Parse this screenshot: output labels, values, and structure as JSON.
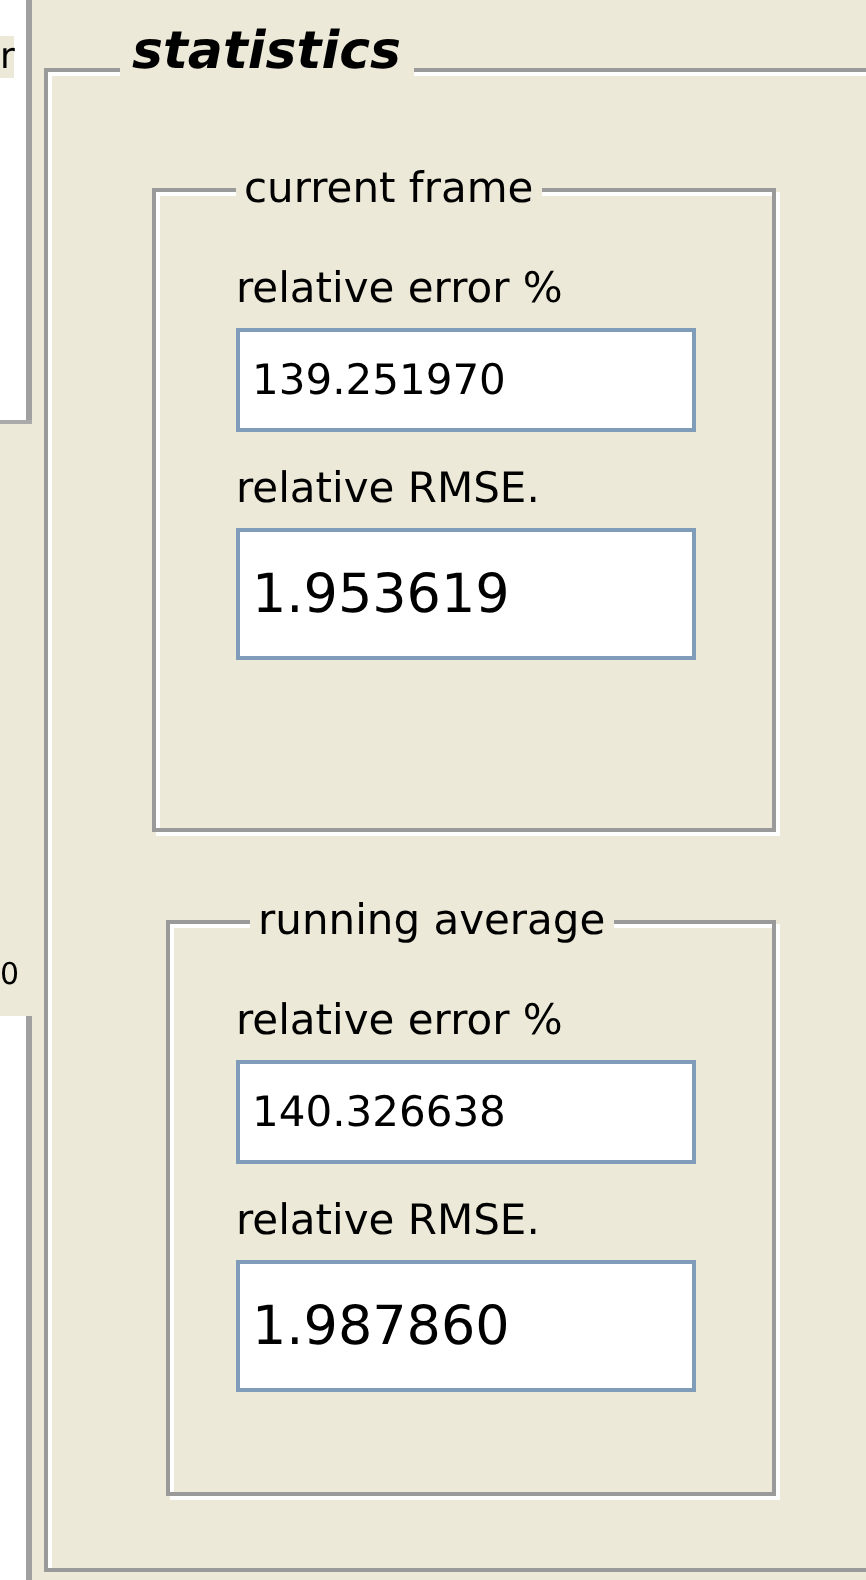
{
  "left_panel": {
    "top_text": "r",
    "bottom_text": "0"
  },
  "statistics": {
    "title": "statistics",
    "groups": [
      {
        "title": "current frame",
        "fields": [
          {
            "label": "relative error %",
            "value": "139.251970",
            "kind": "small"
          },
          {
            "label": "relative RMSE.",
            "value": "1.953619",
            "kind": "large"
          }
        ]
      },
      {
        "title": "running average",
        "fields": [
          {
            "label": "relative error %",
            "value": "140.326638",
            "kind": "small"
          },
          {
            "label": "relative RMSE.",
            "value": "1.987860",
            "kind": "large"
          }
        ]
      }
    ]
  }
}
